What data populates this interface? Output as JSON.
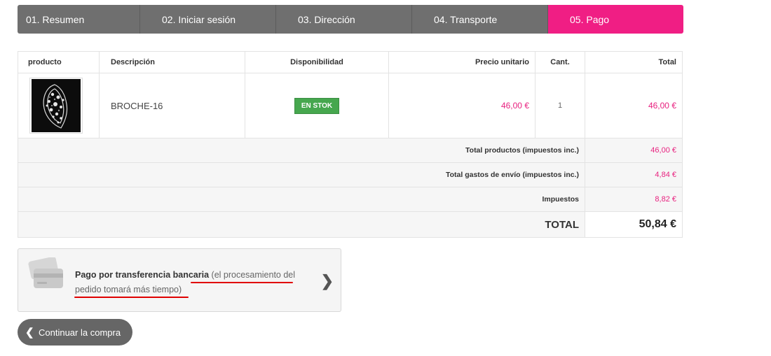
{
  "steps": [
    {
      "label": "01. Resumen",
      "active": false
    },
    {
      "label": "02. Iniciar sesión",
      "active": false
    },
    {
      "label": "03. Dirección",
      "active": false
    },
    {
      "label": "04. Transporte",
      "active": false
    },
    {
      "label": "05. Pago",
      "active": true
    }
  ],
  "cart": {
    "headers": {
      "product": "producto",
      "description": "Descripción",
      "availability": "Disponibilidad",
      "unit_price": "Precio unitario",
      "qty": "Cant.",
      "total": "Total"
    },
    "items": [
      {
        "image_icon": "brooch-image",
        "description": "BROCHE-16",
        "availability": "EN STOK",
        "unit_price": "46,00 €",
        "qty": "1",
        "total": "46,00 €"
      }
    ],
    "summary": {
      "products_label": "Total productos (impuestos inc.)",
      "products_value": "46,00 €",
      "shipping_label": "Total gastos de envío (impuestos inc.)",
      "shipping_value": "4,84 €",
      "taxes_label": "Impuestos",
      "taxes_value": "8,82 €",
      "grand_label": "TOTAL",
      "grand_value": "50,84 €"
    }
  },
  "payment": {
    "icon": "credit-card-icon",
    "title": "Pago por transferencia bancaria",
    "note": "(el procesamiento del pedido tomará más tiempo)",
    "arrow_icon": "chevron-right-icon"
  },
  "continue_button": {
    "label": "Continuar la compra",
    "icon": "chevron-left-icon"
  },
  "colors": {
    "accent": "#f01e84",
    "price": "#e8217f",
    "stock": "#46a74e",
    "step_bg": "#6f6f6f",
    "underline": "#e00000"
  }
}
